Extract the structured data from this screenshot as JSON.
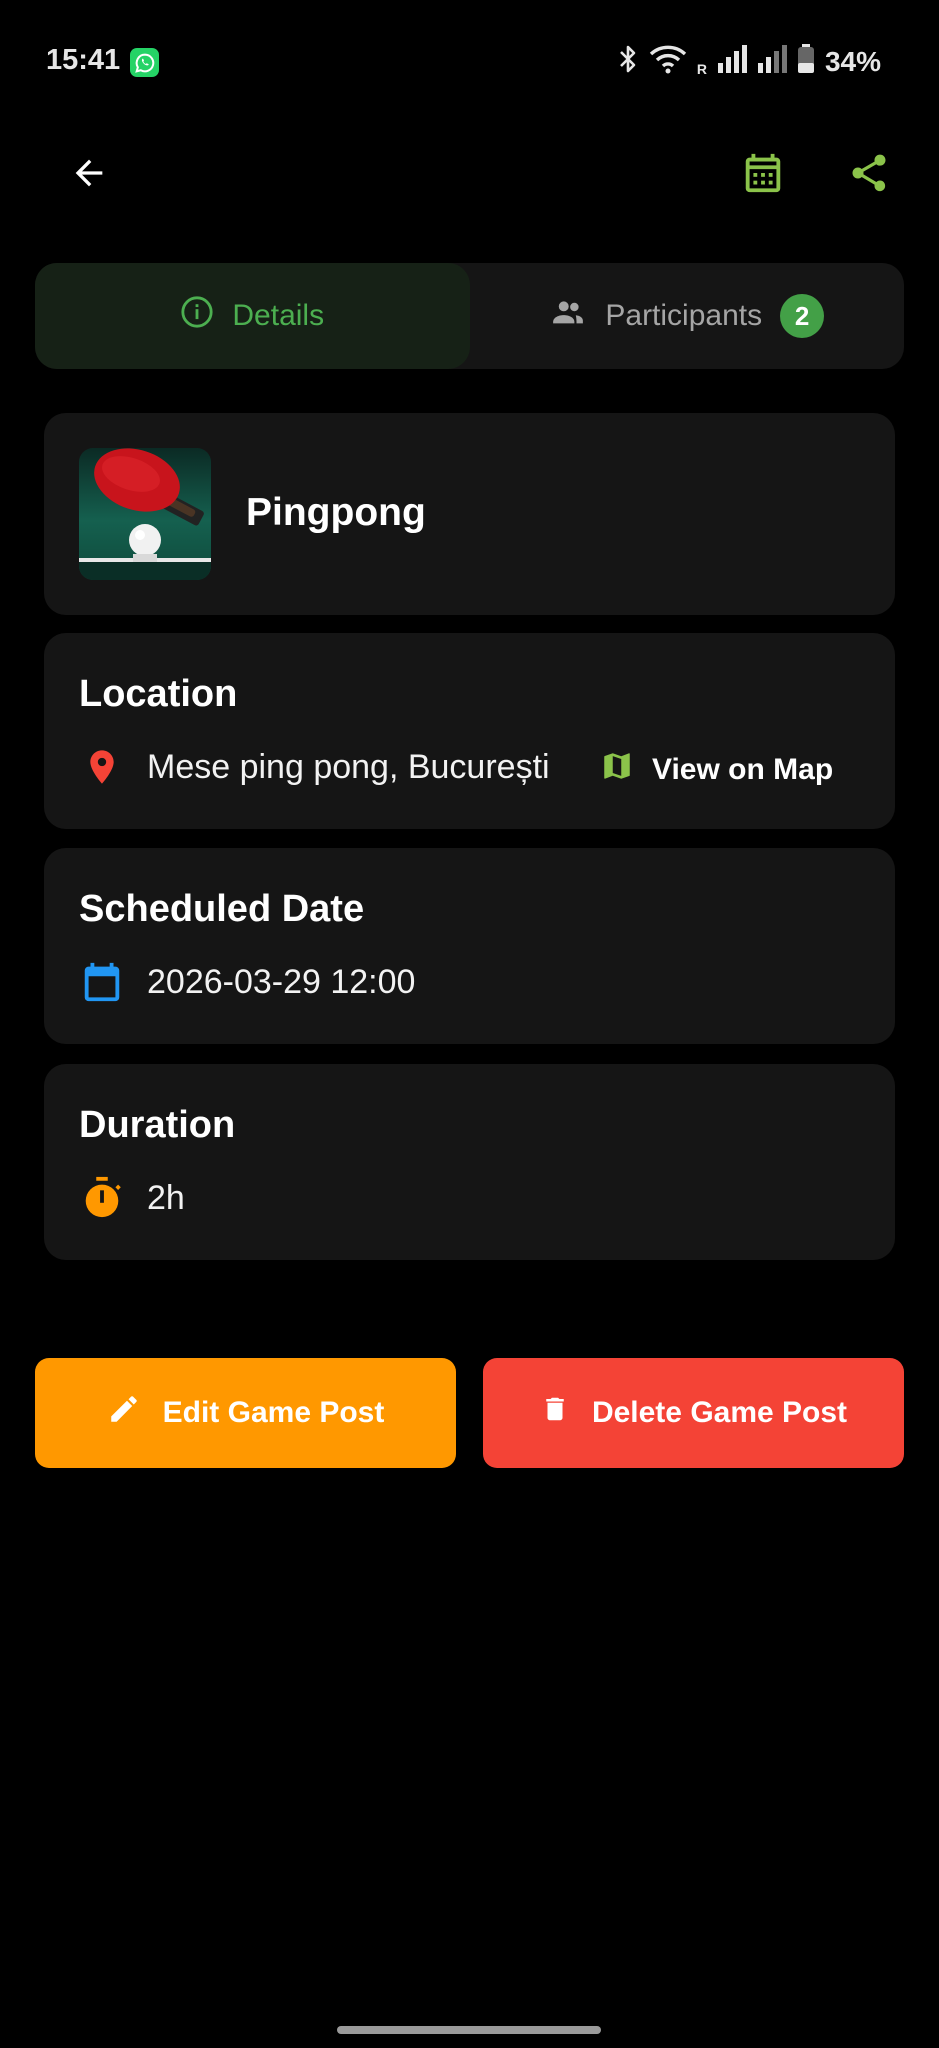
{
  "status_bar": {
    "time": "15:41",
    "battery_percent": "34%",
    "roaming_label": "R",
    "icons": [
      "whatsapp-icon",
      "bluetooth-icon",
      "wifi-icon",
      "signal-icon",
      "signal-icon",
      "battery-icon"
    ]
  },
  "appbar": {
    "icons": [
      "back-arrow-icon",
      "calendar-icon",
      "share-icon"
    ],
    "accent_color": "#8bc34a"
  },
  "tabs": {
    "details_label": "Details",
    "participants_label": "Participants",
    "participants_count": "2",
    "active": "details"
  },
  "sport": {
    "name": "Pingpong",
    "thumbnail": "ping-pong-paddle-and-ball"
  },
  "location": {
    "title": "Location",
    "value": "Mese ping pong, București",
    "map_link_label": "View on Map",
    "pin_color": "#f44336"
  },
  "scheduled_date": {
    "title": "Scheduled Date",
    "value": "2026-03-29 12:00",
    "icon_color": "#2196f3"
  },
  "duration": {
    "title": "Duration",
    "value": "2h",
    "icon_color": "#ff9800"
  },
  "actions": {
    "edit_label": "Edit Game Post",
    "delete_label": "Delete Game Post",
    "edit_color": "#ff9800",
    "delete_color": "#f44336"
  }
}
